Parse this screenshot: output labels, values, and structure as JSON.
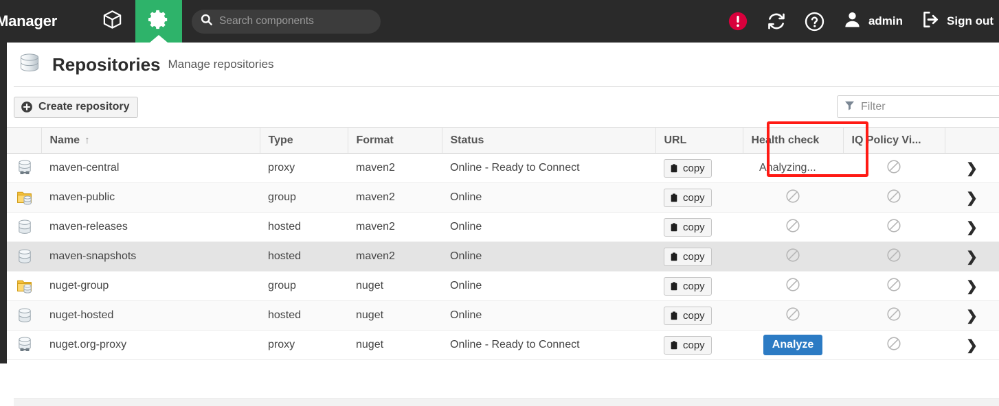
{
  "header": {
    "brand": "Manager",
    "tabs": [
      {
        "name": "browse",
        "icon": "cube-icon",
        "active": false
      },
      {
        "name": "admin",
        "icon": "gear-icon",
        "active": true
      }
    ],
    "search": {
      "placeholder": "Search components",
      "value": ""
    },
    "alert_icon": "alert-circle-icon",
    "refresh_icon": "refresh-icon",
    "help_icon": "help-circle-icon",
    "user_icon": "user-avatar-icon",
    "user_label": "admin",
    "signout_icon": "sign-out-icon",
    "signout_label": "Sign out",
    "accent_green": "#2eb36a",
    "alert_red": "#d8003c",
    "bar_bg": "#2a2a2a"
  },
  "page": {
    "icon": "database-icon",
    "title": "Repositories",
    "subtitle": "Manage repositories"
  },
  "toolbar": {
    "create_label": "Create repository",
    "create_icon": "plus-circle-icon",
    "filter_icon": "funnel-icon",
    "filter_placeholder": "Filter",
    "filter_value": ""
  },
  "table": {
    "columns": [
      {
        "key": "icon",
        "label": ""
      },
      {
        "key": "name",
        "label": "Name"
      },
      {
        "key": "type",
        "label": "Type"
      },
      {
        "key": "format",
        "label": "Format"
      },
      {
        "key": "status",
        "label": "Status"
      },
      {
        "key": "url",
        "label": "URL"
      },
      {
        "key": "health",
        "label": "Health check"
      },
      {
        "key": "iq",
        "label": "IQ Policy Vi..."
      },
      {
        "key": "arrow",
        "label": ""
      }
    ],
    "sort_column": "Name",
    "sort_direction": "ascending",
    "sort_glyph": "↑",
    "copy_label": "copy",
    "copy_icon": "clipboard-icon",
    "analyze_label": "Analyze",
    "analyze_color": "#2c7bc4",
    "blocked_icon": "no-entry-icon",
    "row_arrow_glyph": "❯",
    "rows": [
      {
        "icon": "proxy-repository-icon",
        "name": "maven-central",
        "type": "proxy",
        "format": "maven2",
        "status": "Online - Ready to Connect",
        "url_action": "copy",
        "health": "Analyzing...",
        "health_kind": "text",
        "iq": "blocked",
        "highlighted": false
      },
      {
        "icon": "group-repository-icon",
        "name": "maven-public",
        "type": "group",
        "format": "maven2",
        "status": "Online",
        "url_action": "copy",
        "health": "",
        "health_kind": "blocked",
        "iq": "blocked",
        "highlighted": false
      },
      {
        "icon": "hosted-repository-icon",
        "name": "maven-releases",
        "type": "hosted",
        "format": "maven2",
        "status": "Online",
        "url_action": "copy",
        "health": "",
        "health_kind": "blocked",
        "iq": "blocked",
        "highlighted": false
      },
      {
        "icon": "hosted-repository-icon",
        "name": "maven-snapshots",
        "type": "hosted",
        "format": "maven2",
        "status": "Online",
        "url_action": "copy",
        "health": "",
        "health_kind": "blocked",
        "iq": "blocked",
        "highlighted": true
      },
      {
        "icon": "group-repository-icon",
        "name": "nuget-group",
        "type": "group",
        "format": "nuget",
        "status": "Online",
        "url_action": "copy",
        "health": "",
        "health_kind": "blocked",
        "iq": "blocked",
        "highlighted": false
      },
      {
        "icon": "hosted-repository-icon",
        "name": "nuget-hosted",
        "type": "hosted",
        "format": "nuget",
        "status": "Online",
        "url_action": "copy",
        "health": "",
        "health_kind": "blocked",
        "iq": "blocked",
        "highlighted": false
      },
      {
        "icon": "proxy-repository-icon",
        "name": "nuget.org-proxy",
        "type": "proxy",
        "format": "nuget",
        "status": "Online - Ready to Connect",
        "url_action": "copy",
        "health": "Analyze",
        "health_kind": "button",
        "iq": "blocked",
        "highlighted": false
      }
    ]
  },
  "annotation": {
    "color": "#ff1a14",
    "target": "health-check-column"
  }
}
